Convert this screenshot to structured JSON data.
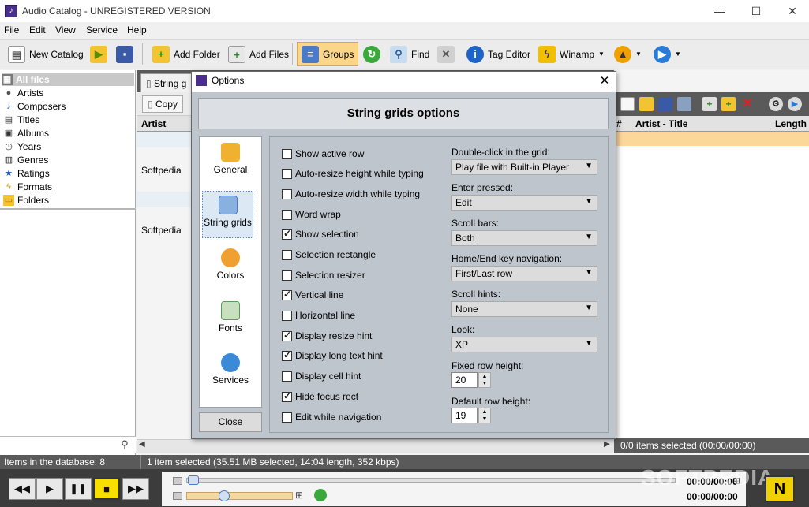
{
  "window": {
    "title": "Audio Catalog - UNREGISTERED VERSION"
  },
  "menu": [
    "File",
    "Edit",
    "View",
    "Service",
    "Help"
  ],
  "toolbar": {
    "new_catalog": "New Catalog",
    "add_folder": "Add Folder",
    "add_files": "Add Files",
    "groups": "Groups",
    "find": "Find",
    "tag_editor": "Tag Editor",
    "winamp": "Winamp"
  },
  "tree": [
    "All files",
    "Artists",
    "Composers",
    "Titles",
    "Albums",
    "Years",
    "Genres",
    "Ratings",
    "Formats",
    "Folders"
  ],
  "center": {
    "tab_label": "String g",
    "copy_label": "Copy",
    "col_artist": "Artist",
    "rows": [
      "Softpedia",
      "Softpedia"
    ]
  },
  "right": {
    "col_num": "#",
    "col_title": "Artist - Title",
    "col_length": "Length",
    "status": "0/0 items selected (00:00/00:00)"
  },
  "status": {
    "items_count": "Items in the database: 8",
    "selection": "1 item selected (35.51 MB selected, 14:04 length, 352 kbps)"
  },
  "player": {
    "time_top": "00:00/00:00",
    "time_bottom": "00:00/00:00",
    "watermark": "SOFTPEDIA"
  },
  "dialog": {
    "title": "Options",
    "header": "String grids options",
    "nav": [
      "General",
      "String grids",
      "Colors",
      "Fonts",
      "Services"
    ],
    "close": "Close",
    "checkboxes": [
      {
        "label": "Show active row",
        "checked": false
      },
      {
        "label": "Auto-resize height while typing",
        "checked": false
      },
      {
        "label": "Auto-resize width while typing",
        "checked": false
      },
      {
        "label": "Word wrap",
        "checked": false
      },
      {
        "label": "Show selection",
        "checked": true
      },
      {
        "label": "Selection rectangle",
        "checked": false
      },
      {
        "label": "Selection resizer",
        "checked": false
      },
      {
        "label": "Vertical line",
        "checked": true
      },
      {
        "label": "Horizontal line",
        "checked": false
      },
      {
        "label": "Display resize hint",
        "checked": true
      },
      {
        "label": "Display long text hint",
        "checked": true
      },
      {
        "label": "Display cell hint",
        "checked": false
      },
      {
        "label": "Hide focus rect",
        "checked": true
      },
      {
        "label": "Edit while navigation",
        "checked": false
      }
    ],
    "fields": [
      {
        "label": "Double-click in the grid:",
        "value": "Play file with Built-in Player"
      },
      {
        "label": "Enter pressed:",
        "value": "Edit"
      },
      {
        "label": "Scroll bars:",
        "value": "Both"
      },
      {
        "label": "Home/End key navigation:",
        "value": "First/Last row"
      },
      {
        "label": "Scroll hints:",
        "value": "None"
      },
      {
        "label": "Look:",
        "value": "XP"
      }
    ],
    "fixed_row_height": {
      "label": "Fixed row height:",
      "value": "20"
    },
    "default_row_height": {
      "label": "Default row height:",
      "value": "19"
    }
  }
}
